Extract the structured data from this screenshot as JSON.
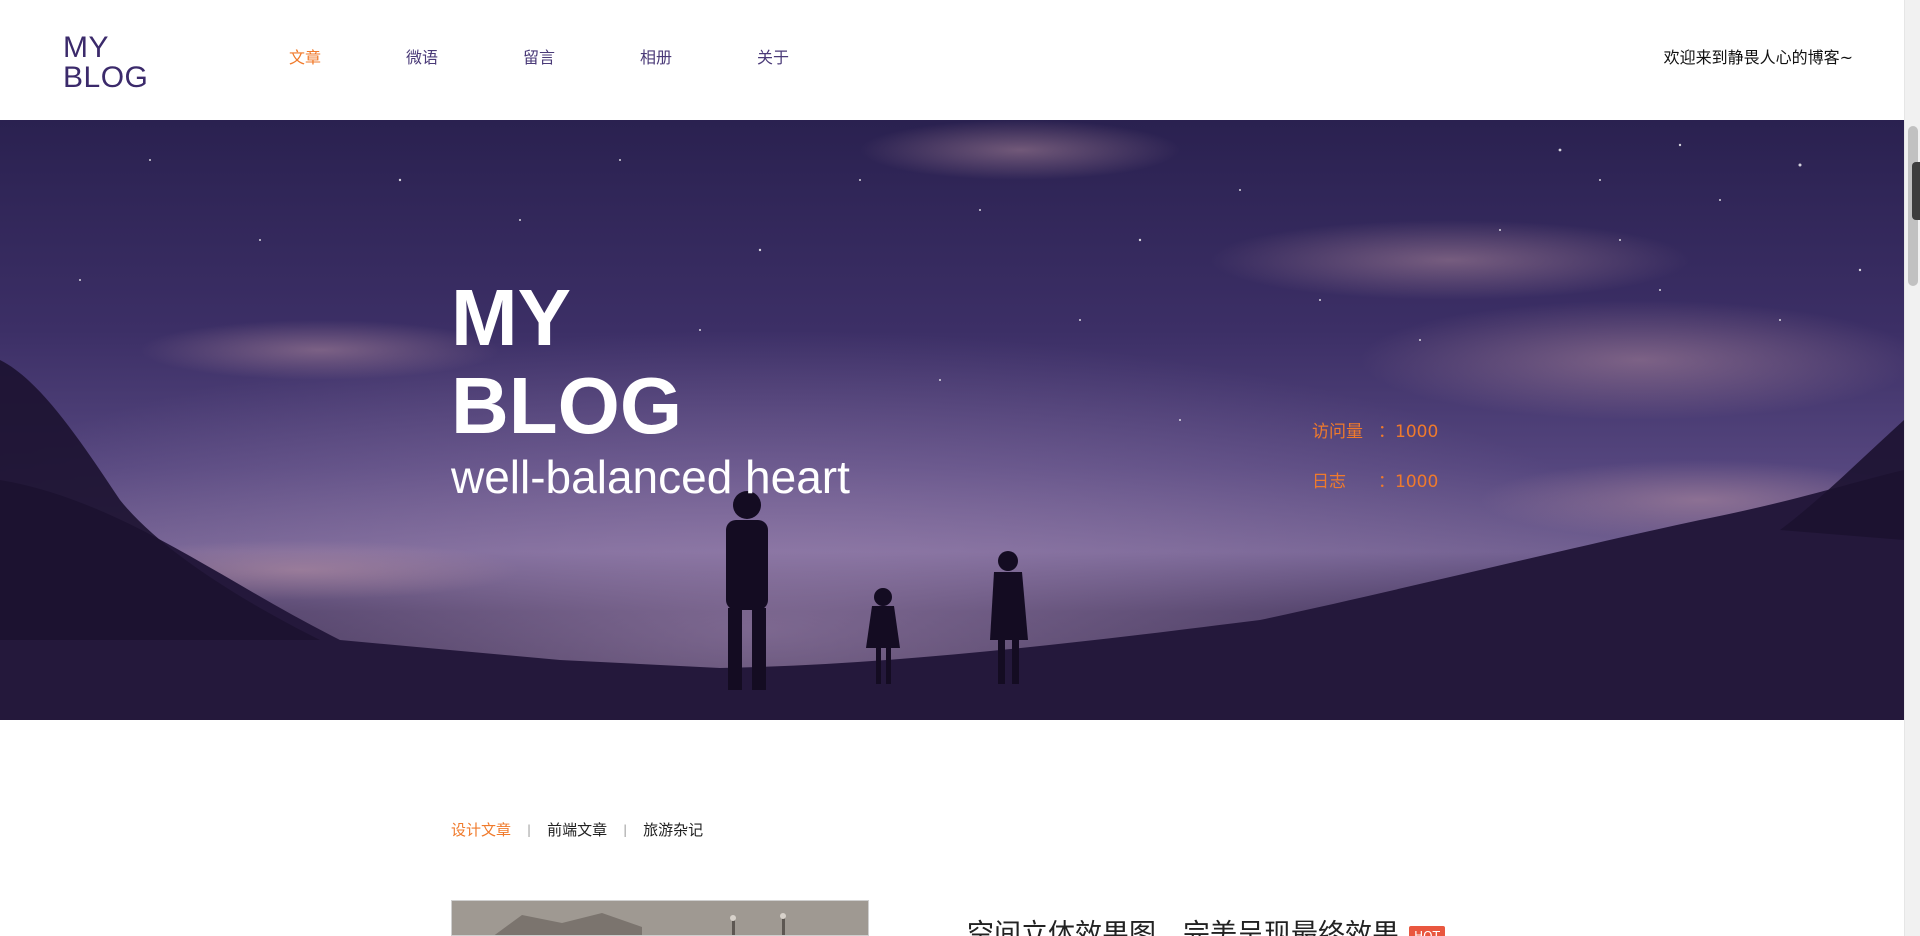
{
  "header": {
    "logo_line1": "MY",
    "logo_line2": "BLOG",
    "nav": [
      {
        "label": "文章",
        "active": true
      },
      {
        "label": "微语",
        "active": false
      },
      {
        "label": "留言",
        "active": false
      },
      {
        "label": "相册",
        "active": false
      },
      {
        "label": "关于",
        "active": false
      }
    ],
    "welcome": "欢迎来到静畏人心的博客~"
  },
  "hero": {
    "title_line1": "MY",
    "title_line2": "BLOG",
    "subtitle": "well-balanced heart",
    "stats": [
      {
        "label": "访问量",
        "value": "：1000"
      },
      {
        "label": "日志",
        "value": "：1000"
      }
    ]
  },
  "categories": [
    {
      "label": "设计文章",
      "active": true
    },
    {
      "label": "前端文章",
      "active": false
    },
    {
      "label": "旅游杂记",
      "active": false
    }
  ],
  "category_separator": "|",
  "article": {
    "title": "空间立体效果图，完美呈现最终效果",
    "badge": "HOT"
  },
  "colors": {
    "accent": "#f07a2b",
    "logo": "#3b2a6b",
    "hero_sky": "#3c2f66"
  }
}
